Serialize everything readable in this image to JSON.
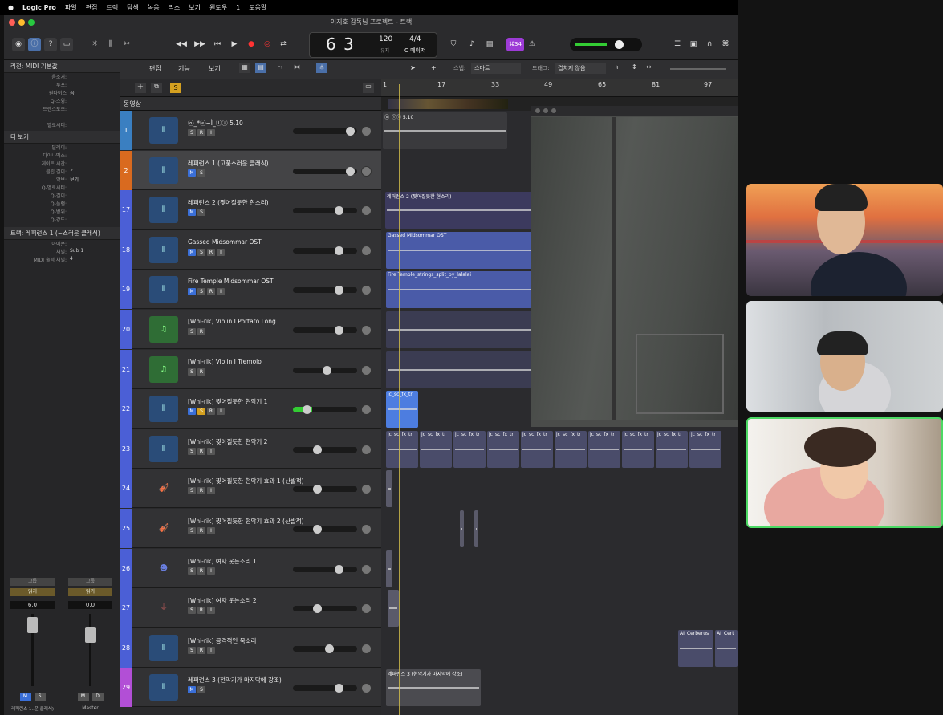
{
  "menubar": [
    "Logic Pro",
    "파일",
    "편집",
    "트랙",
    "탐색",
    "녹음",
    "믹스",
    "보기",
    "윈도우",
    "1",
    "도움말"
  ],
  "window_title": "이지호 감독님 프로젝트 - 트랙",
  "toolbar": {
    "lcd_bar": "6",
    "lcd_beat": "3",
    "tempo": "120",
    "tempo_label": "유지",
    "sig": "4/4",
    "key": "C 메이저",
    "count": "⌘34"
  },
  "controlbar": {
    "edit": "편집",
    "function": "기능",
    "view": "보기",
    "snap_label": "스냅:",
    "snap": "스마트",
    "drag_label": "드래그:",
    "drag": "겹치지 않음"
  },
  "inspector": {
    "region_header": "리전: MIDI 기본값",
    "region_rows": [
      [
        "음소거:",
        ""
      ],
      [
        "루프:",
        ""
      ],
      [
        "퀀타이즈",
        "끔"
      ],
      [
        "Q-스윙:",
        ""
      ],
      [
        "트랜스포즈:",
        ""
      ],
      [
        "",
        ""
      ],
      [
        "벨로시티:",
        ""
      ]
    ],
    "more_header": "더 보기",
    "more_rows": [
      [
        "딜레이:",
        ""
      ],
      [
        "다이나믹스:",
        ""
      ],
      [
        "게이트 시간:",
        ""
      ],
      [
        "클립 길이:",
        "✓"
      ],
      [
        "악보:",
        "보기"
      ],
      [
        "Q-벨로시티:",
        ""
      ],
      [
        "Q-길이:",
        ""
      ],
      [
        "Q-플램:",
        ""
      ],
      [
        "Q-범위:",
        ""
      ],
      [
        "Q-강도:",
        ""
      ]
    ],
    "track_header": "트랙: 레퍼런스 1 (~스러운 클래식)",
    "track_rows": [
      [
        "아이콘:",
        ""
      ],
      [
        "채널:",
        "Sub 1"
      ],
      [
        "MIDI 출력 채널:",
        "4"
      ]
    ],
    "ch_label1": "그룹",
    "ch_label2": "그룹",
    "read1": "읽기",
    "read2": "읽기",
    "val1": "6.0",
    "val2": "0.0",
    "m1": "M",
    "s1": "S",
    "m2": "M",
    "d2": "D",
    "strip1": "레퍼런스 1..운 클래식)",
    "strip2": "Master"
  },
  "movie_label": "동영상",
  "ruler": [
    "1",
    "17",
    "33",
    "49",
    "65",
    "81",
    "97"
  ],
  "tracks": [
    {
      "num": "1",
      "name": "ⓞ_*ⓔ~Ì_ⓛⓘ 5.10",
      "btns": [
        "S",
        "R",
        "I"
      ],
      "color": "#3a7fc1",
      "icon": "wave"
    },
    {
      "num": "2",
      "name": "레퍼런스 1 (고풍스러운 클래식)",
      "btns": [
        "M",
        "S"
      ],
      "color": "#d96a1f",
      "icon": "wave"
    },
    {
      "num": "17",
      "name": "레퍼런스 2 (찢어질듯한 현소리)",
      "btns": [
        "M",
        "S"
      ],
      "color": "#4b5fd6",
      "icon": "wave"
    },
    {
      "num": "18",
      "name": "Gassed  Midsommar OST",
      "btns": [
        "M",
        "S",
        "R",
        "I"
      ],
      "color": "#4b5fd6",
      "icon": "wave"
    },
    {
      "num": "19",
      "name": "Fire Temple Midsommar OST",
      "btns": [
        "M",
        "S",
        "R",
        "I"
      ],
      "color": "#4b5fd6",
      "icon": "wave"
    },
    {
      "num": "20",
      "name": "[Whi-rik] Violin I Portato Long",
      "btns": [
        "S",
        "R"
      ],
      "color": "#4b5fd6",
      "icon": "note"
    },
    {
      "num": "21",
      "name": "[Whi-rik] Violin I Tremolo",
      "btns": [
        "S",
        "R"
      ],
      "color": "#4b5fd6",
      "icon": "note"
    },
    {
      "num": "22",
      "name": "[Whi-rik] 찢어질듯한 현악기 1",
      "btns": [
        "M",
        "S",
        "R",
        "I"
      ],
      "color": "#4b5fd6",
      "icon": "wave"
    },
    {
      "num": "23",
      "name": "[Whi-rik] 찢어질듯한 현악기 2",
      "btns": [
        "S",
        "R",
        "I"
      ],
      "color": "#4b5fd6",
      "icon": "wave"
    },
    {
      "num": "24",
      "name": "[Whi-rik] 찢어질듯한 현악기 효과 1 (산발적)",
      "btns": [
        "S",
        "R",
        "I"
      ],
      "color": "#4b5fd6",
      "icon": "violin"
    },
    {
      "num": "25",
      "name": "[Whi-rik] 찢어질듯한 현악기 효과 2 (산발적)",
      "btns": [
        "S",
        "R",
        "I"
      ],
      "color": "#4b5fd6",
      "icon": "violin"
    },
    {
      "num": "26",
      "name": "[Whi-rik] 여자 웃는소리 1",
      "btns": [
        "S",
        "R",
        "I"
      ],
      "color": "#4b5fd6",
      "icon": "voice"
    },
    {
      "num": "27",
      "name": "[Whi-rik] 여자 웃는소리 2",
      "btns": [
        "S",
        "R",
        "I"
      ],
      "color": "#4b5fd6",
      "icon": "mic"
    },
    {
      "num": "28",
      "name": "[Whi-rik] 공격적인 북소리",
      "btns": [
        "S",
        "R",
        "I"
      ],
      "color": "#4b5fd6",
      "icon": "wave"
    },
    {
      "num": "29",
      "name": "레퍼런스 3 (현악기가 마지막에 강조)",
      "btns": [
        "M",
        "S"
      ],
      "color": "#b24fd6",
      "icon": "wave"
    }
  ],
  "regions": {
    "r1": "ⓞ_ⓛⓘ 5.10",
    "r17": "레퍼런스 2 (찢어질듯한 현소리)",
    "r18": "Gassed  Midsommar OST",
    "r19": "Fire Temple_strings_split_by_lalalai",
    "r22": "jc_sc_fx_tr",
    "r23": "jc_sc_fx_tr",
    "r28a": "AI_Cerberus",
    "r28b": "AI_Cert",
    "r29": "레퍼런스 3 (현악기가 마지막에 강조)"
  },
  "icon_names": {
    "wave": "waveform-icon",
    "note": "music-note-icon",
    "violin": "violin-icon",
    "voice": "voice-icon",
    "mic": "microphone-icon"
  }
}
